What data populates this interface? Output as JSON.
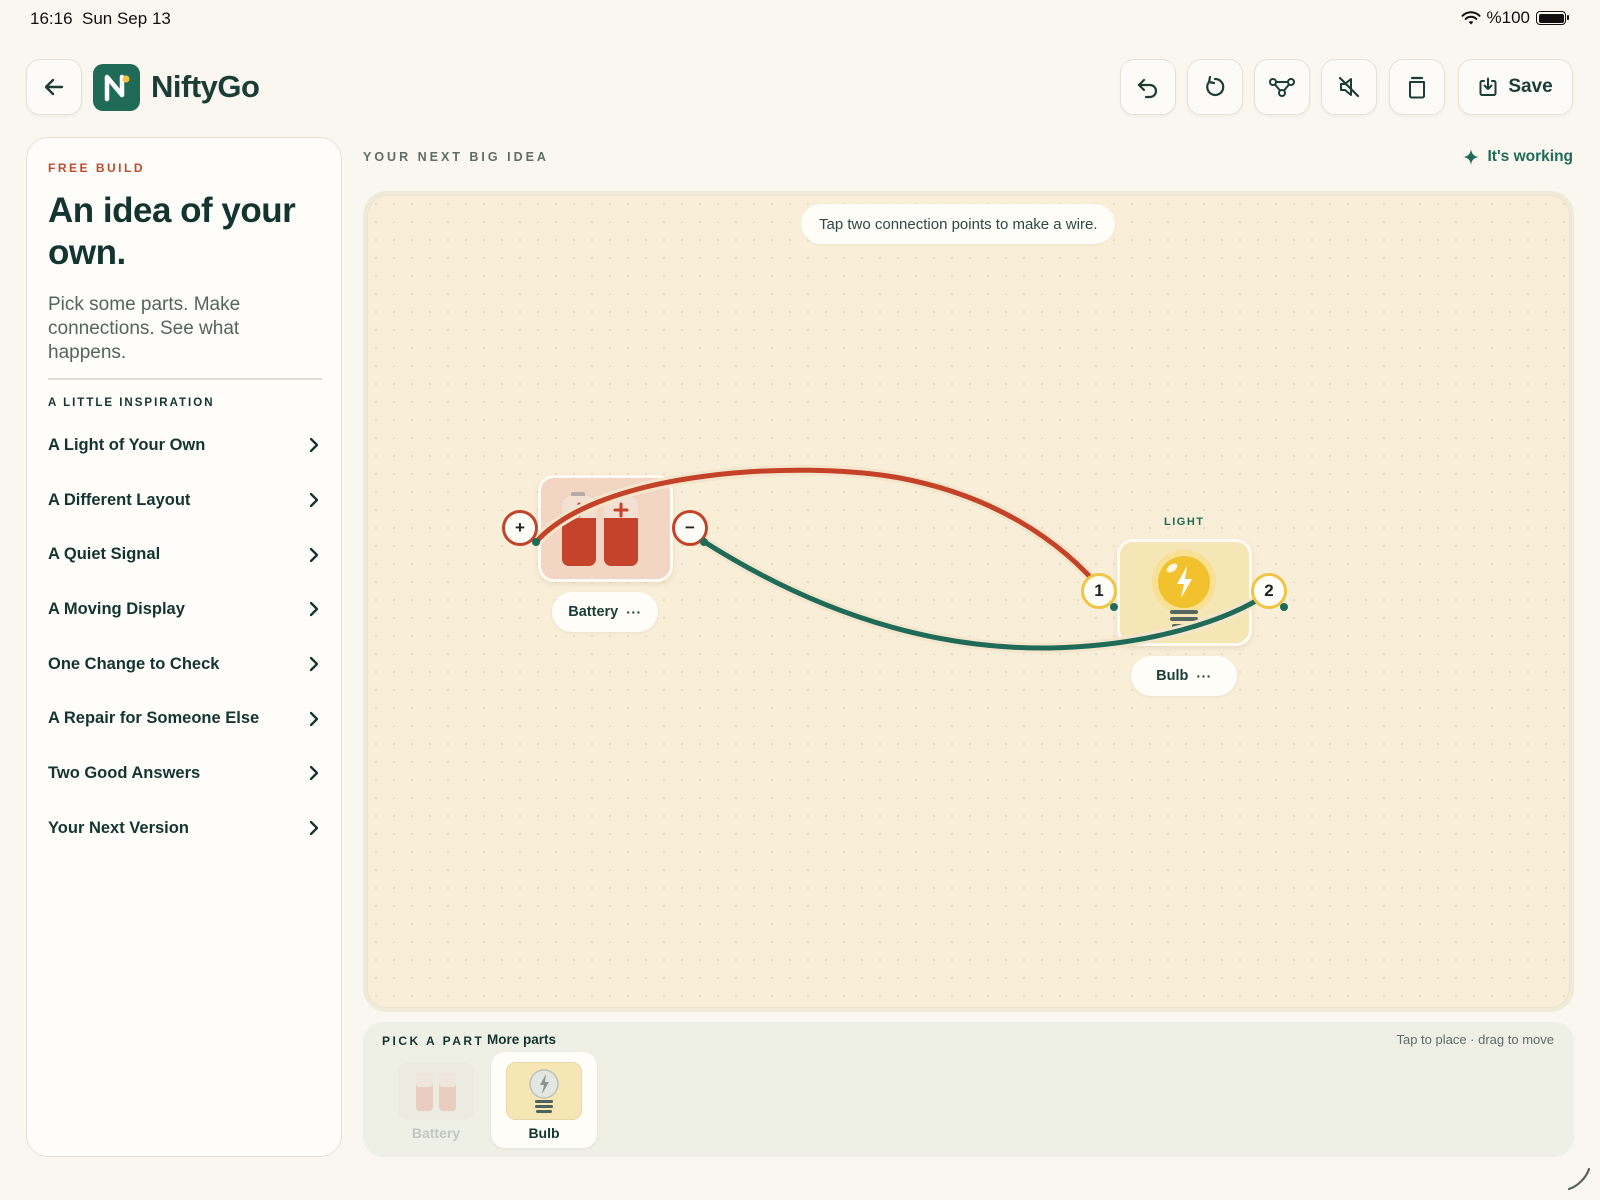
{
  "status_bar": {
    "time": "16:16",
    "date": "Sun Sep 13",
    "battery": "%100"
  },
  "header": {
    "app_name": "NiftyGo",
    "logo_letter": "N",
    "save_label": "Save",
    "toolbar_icons": [
      "undo-icon",
      "reset-icon",
      "connections-icon",
      "mute-icon",
      "delete-icon"
    ]
  },
  "sidebar": {
    "kicker": "FREE BUILD",
    "headline": "An idea of your own.",
    "subtitle": "Pick some parts. Make connections. See what happens.",
    "inspiration_title": "A LITTLE INSPIRATION",
    "items": [
      {
        "label": "A Light of Your Own"
      },
      {
        "label": "A Different Layout"
      },
      {
        "label": "A Quiet Signal"
      },
      {
        "label": "A Moving Display"
      },
      {
        "label": "One Change to Check"
      },
      {
        "label": "A Repair for Someone Else"
      },
      {
        "label": "Two Good Answers"
      },
      {
        "label": "Your Next Version"
      }
    ]
  },
  "canvas": {
    "section_label": "YOUR NEXT BIG IDEA",
    "status": "It's working",
    "hint": "Tap two connection points to make a wire.",
    "battery": {
      "label": "Battery",
      "terminal_plus": "+",
      "terminal_minus": "−"
    },
    "bulb": {
      "tag": "LIGHT",
      "label": "Bulb",
      "terminal_1": "1",
      "terminal_2": "2"
    },
    "more_glyph": "···",
    "colors": {
      "positive_wire": "#c44328",
      "negative_wire": "#1f6b58",
      "accent": "#1f6b58",
      "kicker": "#c24a2c"
    }
  },
  "tray": {
    "title": "PICK A PART",
    "more": "More parts",
    "note": "Tap to place · drag to move",
    "parts": [
      {
        "name": "Battery",
        "state": "disabled"
      },
      {
        "name": "Bulb",
        "state": "available"
      }
    ]
  }
}
